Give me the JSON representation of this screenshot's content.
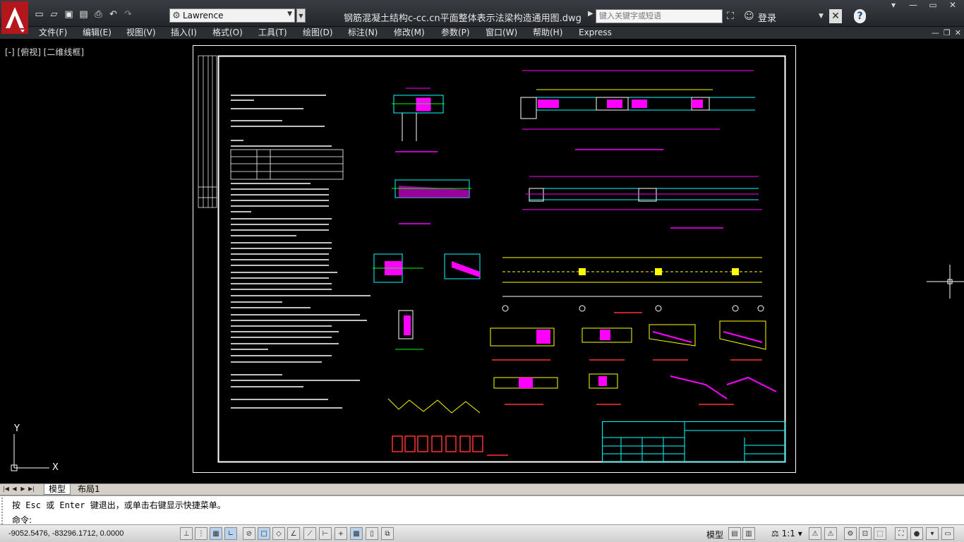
{
  "title_bar": {
    "workspace": "Lawrence",
    "document_title": "钢筋混凝土结构c-cc.cn平面整体表示法梁构造通用图.dwg",
    "search_placeholder": "键入关键字或短语",
    "login_label": "登录"
  },
  "menu": [
    "文件(F)",
    "编辑(E)",
    "视图(V)",
    "插入(I)",
    "格式(O)",
    "工具(T)",
    "绘图(D)",
    "标注(N)",
    "修改(M)",
    "参数(P)",
    "窗口(W)",
    "帮助(H)",
    "Express"
  ],
  "viewport": {
    "label": "[-] [俯视] [二维线框]",
    "ucs_x": "X",
    "ucs_y": "Y"
  },
  "tabs": [
    "模型",
    "布局1"
  ],
  "command": {
    "line1": "按 Esc 或 Enter 键退出，或单击右键显示快捷菜单。",
    "prompt": "命令:"
  },
  "status": {
    "coordinates": "-9052.5476,  -83296.1712, 0.0000",
    "model_label": "模型",
    "annotation_scale": "1:1"
  },
  "colors": {
    "magenta": "#ff00ff",
    "cyan": "#00ffff",
    "yellow": "#ffff00",
    "green": "#00ff00",
    "red": "#ff3030"
  }
}
